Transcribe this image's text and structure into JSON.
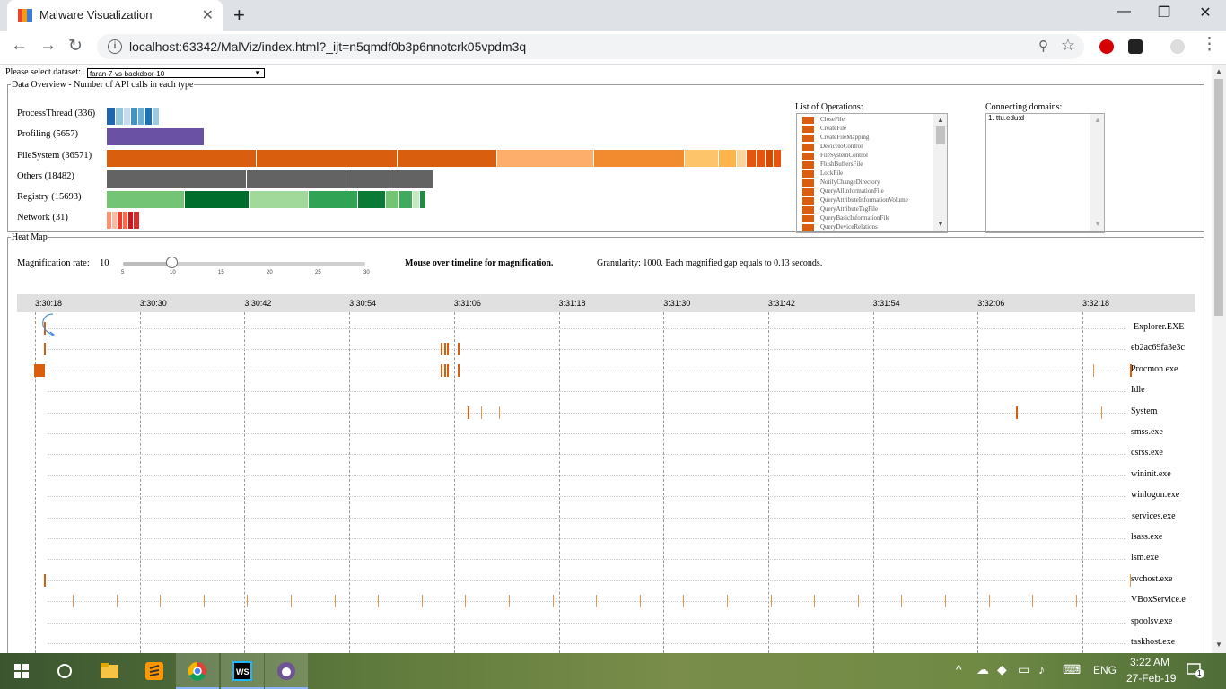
{
  "browser": {
    "tab_title": "Malware Visualization",
    "tab_close": "✕",
    "new_tab": "+",
    "url": "localhost:63342/MalViz/index.html?_ijt=n5qmdf0b3p6nnotcrk05vpdm3q",
    "window_controls": {
      "minimize": "—",
      "maximize": "❐",
      "close": "✕"
    }
  },
  "dataset": {
    "label": "Please select dataset:",
    "selected": "faran-7-vs-backdoor-10"
  },
  "overview": {
    "legend": "Data Overview - Number of API calls in each type",
    "categories": [
      {
        "label": "ProcessThread (336)",
        "name": "ProcessThread",
        "count": 336
      },
      {
        "label": "Profiling (5657)",
        "name": "Profiling",
        "count": 5657
      },
      {
        "label": "FileSystem (36571)",
        "name": "FileSystem",
        "count": 36571
      },
      {
        "label": "Others (18482)",
        "name": "Others",
        "count": 18482
      },
      {
        "label": "Registry (15693)",
        "name": "Registry",
        "count": 15693
      },
      {
        "label": "Network (31)",
        "name": "Network",
        "count": 31
      }
    ],
    "colors": {
      "ProcessThread": [
        "#2166ac",
        "#92c5de",
        "#c6dbef",
        "#4393c3",
        "#6baed6",
        "#2171b5",
        "#9ecae1"
      ],
      "Profiling": [
        "#6a51a3"
      ],
      "FileSystem": [
        "#d95f0e",
        "#d95f0e",
        "#d95f0e",
        "#fdae6b",
        "#f28b30",
        "#fdc46a",
        "#fdb44a",
        "#fdd49e",
        "#e6550d",
        "#e6550d",
        "#d94801",
        "#e6550d"
      ],
      "Others": [
        "#636363",
        "#636363",
        "#636363",
        "#636363",
        "#636363"
      ],
      "Registry": [
        "#74c476",
        "#006d2c",
        "#a1d99b",
        "#31a354",
        "#0b7a34",
        "#74c476",
        "#41ab5d",
        "#c7e9c0",
        "#238b45"
      ],
      "Network": [
        "#fc9272",
        "#fcbba1",
        "#ef3b2c",
        "#fb6a4a",
        "#cb181d",
        "#de2d26"
      ]
    },
    "operations_title": "List of Operations:",
    "operations": [
      "CloseFile",
      "CreateFile",
      "CreateFileMapping",
      "DeviceIoControl",
      "FileSystemControl",
      "FlushBuffersFile",
      "LockFile",
      "NotifyChangeDirectory",
      "QueryAllInformationFile",
      "QueryAttributeInformationVolume",
      "QueryAttributeTagFile",
      "QueryBasicInformationFile",
      "QueryDeviceRelations"
    ],
    "domains_title": "Connecting domains:",
    "domains": [
      "1. ttu.edu:d"
    ]
  },
  "heatmap": {
    "legend": "Heat Map",
    "magnification_label": "Magnification rate:",
    "magnification_value": "10",
    "slider": {
      "min": 5,
      "max": 30,
      "value": 10,
      "ticks": [
        "5",
        "10",
        "15",
        "20",
        "25",
        "30"
      ]
    },
    "hint": "Mouse over timeline for magnification.",
    "granularity": "Granularity: 1000. Each magnified gap equals to 0.13 seconds.",
    "time_ticks": [
      "3:30:18",
      "3:30:30",
      "3:30:42",
      "3:30:54",
      "3:31:06",
      "3:31:18",
      "3:31:30",
      "3:31:42",
      "3:31:54",
      "3:32:06",
      "3:32:18"
    ],
    "processes": [
      "Explorer.EXE",
      "eb2ac69fa3e3c",
      "Procmon.exe",
      "Idle",
      "System",
      "smss.exe",
      "csrss.exe",
      "wininit.exe",
      "winlogon.exe",
      "services.exe",
      "lsass.exe",
      "lsm.exe",
      "svchost.exe",
      "VBoxService.e",
      "spoolsv.exe",
      "taskhost.exe"
    ]
  },
  "taskbar": {
    "time": "3:22 AM",
    "date": "27-Feb-19",
    "lang": "ENG",
    "notification_count": "1"
  }
}
